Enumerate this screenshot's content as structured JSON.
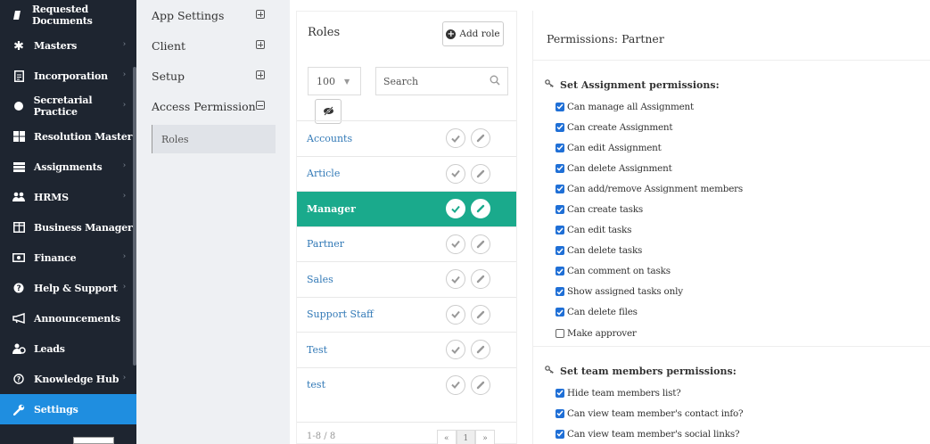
{
  "sidebar": {
    "items": [
      {
        "label": "Requested Documents",
        "icon": "document-icon",
        "chevron": false,
        "active": false
      },
      {
        "label": "Masters",
        "icon": "asterisk-icon",
        "chevron": true,
        "active": false
      },
      {
        "label": "Incorporation",
        "icon": "file-icon",
        "chevron": true,
        "active": false
      },
      {
        "label": "Secretarial Practice",
        "icon": "circle-icon",
        "chevron": true,
        "active": false
      },
      {
        "label": "Resolution Master",
        "icon": "grid-icon",
        "chevron": true,
        "active": false
      },
      {
        "label": "Assignments",
        "icon": "list-icon",
        "chevron": true,
        "active": false
      },
      {
        "label": "HRMS",
        "icon": "users-icon",
        "chevron": true,
        "active": false
      },
      {
        "label": "Business Manager",
        "icon": "columns-icon",
        "chevron": true,
        "active": false
      },
      {
        "label": "Finance",
        "icon": "money-icon",
        "chevron": true,
        "active": false
      },
      {
        "label": "Help & Support",
        "icon": "question-icon",
        "chevron": true,
        "active": false
      },
      {
        "label": "Announcements",
        "icon": "megaphone-icon",
        "chevron": false,
        "active": false
      },
      {
        "label": "Leads",
        "icon": "leads-icon",
        "chevron": false,
        "active": false
      },
      {
        "label": "Knowledge Hub",
        "icon": "knowledge-icon",
        "chevron": true,
        "active": false
      },
      {
        "label": "Settings",
        "icon": "wrench-icon",
        "chevron": false,
        "active": true
      }
    ]
  },
  "submenu": {
    "items": [
      {
        "label": "App Settings",
        "expanded": false
      },
      {
        "label": "Client",
        "expanded": false
      },
      {
        "label": "Setup",
        "expanded": false
      },
      {
        "label": "Access Permission",
        "expanded": true
      }
    ],
    "sub_item": "Roles"
  },
  "roles": {
    "title": "Roles",
    "add_label": "Add role",
    "per_page": "100",
    "search_placeholder": "Search",
    "list": [
      {
        "name": "Accounts",
        "active": false
      },
      {
        "name": "Article",
        "active": false
      },
      {
        "name": "Manager",
        "active": true
      },
      {
        "name": "Partner",
        "active": false
      },
      {
        "name": "Sales",
        "active": false
      },
      {
        "name": "Support Staff",
        "active": false
      },
      {
        "name": "Test",
        "active": false
      },
      {
        "name": "test",
        "active": false
      }
    ],
    "pagination_info": "1-8 / 8",
    "pager": {
      "prev": "«",
      "current": "1",
      "next": "»"
    }
  },
  "permissions": {
    "title": "Permissions: Partner",
    "sections": [
      {
        "title": "Set Assignment permissions:",
        "items": [
          {
            "label": "Can manage all Assignment",
            "checked": true
          },
          {
            "label": "Can create Assignment",
            "checked": true
          },
          {
            "label": "Can edit Assignment",
            "checked": true
          },
          {
            "label": "Can delete Assignment",
            "checked": true
          },
          {
            "label": "Can add/remove Assignment members",
            "checked": true
          },
          {
            "label": "Can create tasks",
            "checked": true
          },
          {
            "label": "Can edit tasks",
            "checked": true
          },
          {
            "label": "Can delete tasks",
            "checked": true
          },
          {
            "label": "Can comment on tasks",
            "checked": true
          },
          {
            "label": "Show assigned tasks only",
            "checked": true
          },
          {
            "label": "Can delete files",
            "checked": true
          },
          {
            "label": "Make approver",
            "checked": false
          }
        ]
      },
      {
        "title": "Set team members permissions:",
        "items": [
          {
            "label": "Hide team members list?",
            "checked": true
          },
          {
            "label": "Can view team member's contact info?",
            "checked": true
          },
          {
            "label": "Can view team member's social links?",
            "checked": true
          }
        ]
      }
    ]
  },
  "colors": {
    "sidebar_bg": "#1e2530",
    "sidebar_active": "#1f8ee0",
    "role_active": "#1aaa8c",
    "checkbox": "#1f6fd6",
    "link": "#337ab7"
  }
}
